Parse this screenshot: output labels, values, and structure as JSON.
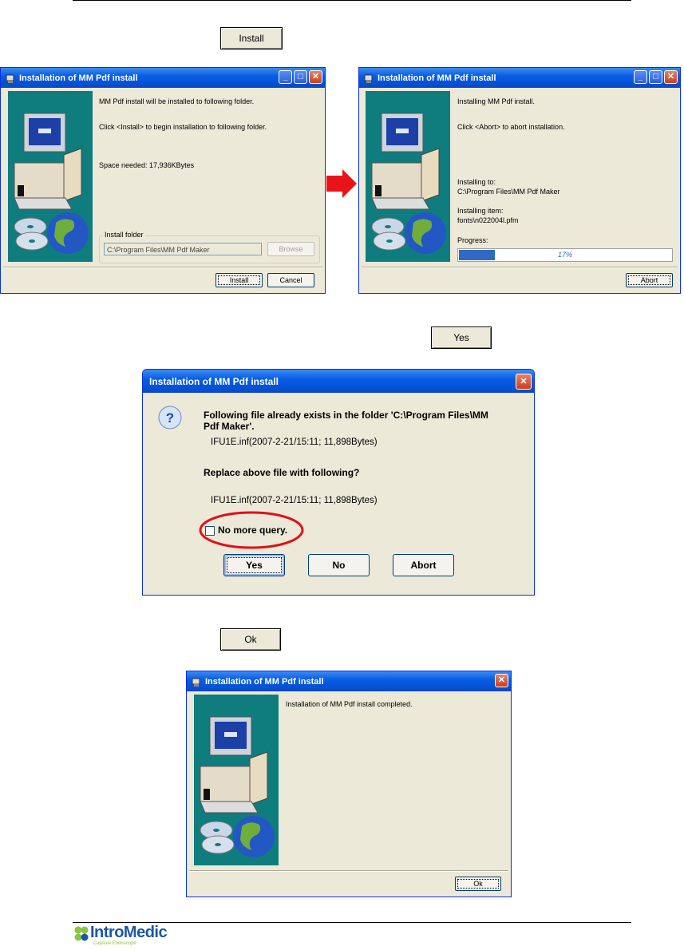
{
  "doc": {
    "install_button_label": "Install",
    "yes_button_label": "Yes",
    "ok_button_label": "Ok"
  },
  "window_install": {
    "title": "Installation of MM Pdf install",
    "line1": "MM Pdf install will be installed to following folder.",
    "line2": "Click <Install> to begin installation to following folder.",
    "space": "Space needed: 17,936KBytes",
    "group_label": "Install folder",
    "folder": "C:\\Program Files\\MM Pdf Maker",
    "browse": "Browse",
    "install": "Install",
    "cancel": "Cancel"
  },
  "window_progress": {
    "title": "Installation of MM Pdf install",
    "line1": "Installing MM Pdf install.",
    "line2": "Click <Abort> to abort installation.",
    "installing_to_label": "Installing to:",
    "installing_to": "C:\\Program Files\\MM Pdf Maker",
    "installing_item_label": "Installing item:",
    "installing_item": "fonts\\n022004l.pfm",
    "progress_label": "Progress:",
    "progress_text": "17%",
    "progress_value": 0.17,
    "abort": "Abort"
  },
  "dialog_replace": {
    "title": "Installation of MM Pdf install",
    "message_line1": "Following file already exists in the folder 'C:\\Program Files\\MM",
    "message_line2": "Pdf Maker'.",
    "existing_file": "IFU1E.inf(2007-2-21/15:11; 11,898Bytes)",
    "question": "Replace above file with following?",
    "new_file": "IFU1E.inf(2007-2-21/15:11; 11,898Bytes)",
    "checkbox_label": "No more query.",
    "yes": "Yes",
    "no": "No",
    "abort": "Abort",
    "highlight_color": "#e0101a"
  },
  "window_complete": {
    "title": "Installation of MM Pdf install",
    "message": "Installation of MM Pdf install completed.",
    "ok": "Ok"
  },
  "footer": {
    "logo_text": "IntroMedic",
    "logo_tagline": "Capsule Endoscope",
    "logo_colors": {
      "green": "#8bc43f",
      "blue": "#1b56a5"
    }
  }
}
